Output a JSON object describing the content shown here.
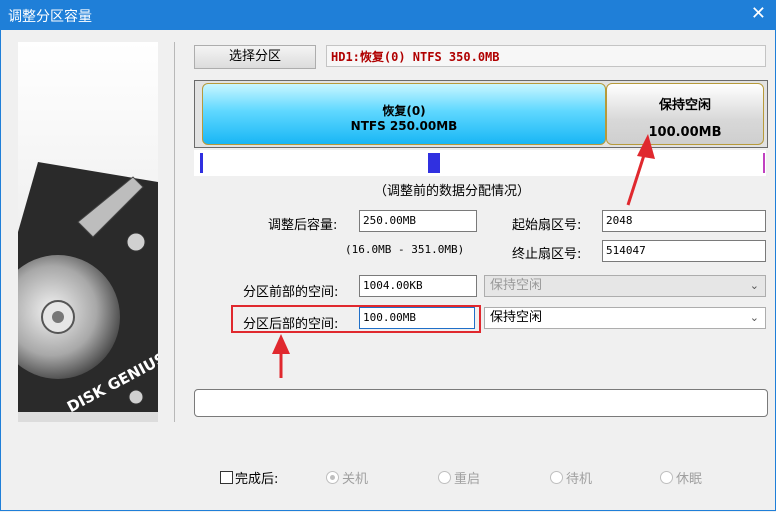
{
  "window": {
    "title": "调整分区容量",
    "close_label": "✕"
  },
  "side_image": {
    "logo_text": "DISK GENIUS",
    "icon": "hard-disk-illustration"
  },
  "select_partition": {
    "button_label": "选择分区",
    "info": "HD1:恢复(0) NTFS 350.0MB"
  },
  "map": {
    "partition": {
      "name": "恢复(0)",
      "detail": "NTFS 250.00MB"
    },
    "free": {
      "label": "保持空闲",
      "size": "100.00MB"
    },
    "caption": "（调整前的数据分配情况）"
  },
  "form": {
    "new_size": {
      "label": "调整后容量:",
      "value": "250.00MB",
      "range": "(16.0MB - 351.0MB)"
    },
    "start_sector": {
      "label": "起始扇区号:",
      "value": "2048"
    },
    "end_sector": {
      "label": "终止扇区号:",
      "value": "514047"
    },
    "before_space": {
      "label": "分区前部的空间:",
      "value": "1004.00KB",
      "action": "保持空闲"
    },
    "after_space": {
      "label": "分区后部的空间:",
      "value": "100.00MB",
      "action": "保持空闲"
    }
  },
  "after_complete": {
    "label": "完成后:",
    "options": [
      "关机",
      "重启",
      "待机",
      "休眠"
    ],
    "selected": "关机"
  },
  "colors": {
    "title_bar": "#1f7fd8",
    "highlight_box": "#e0282e",
    "arrow": "#e0282e"
  }
}
